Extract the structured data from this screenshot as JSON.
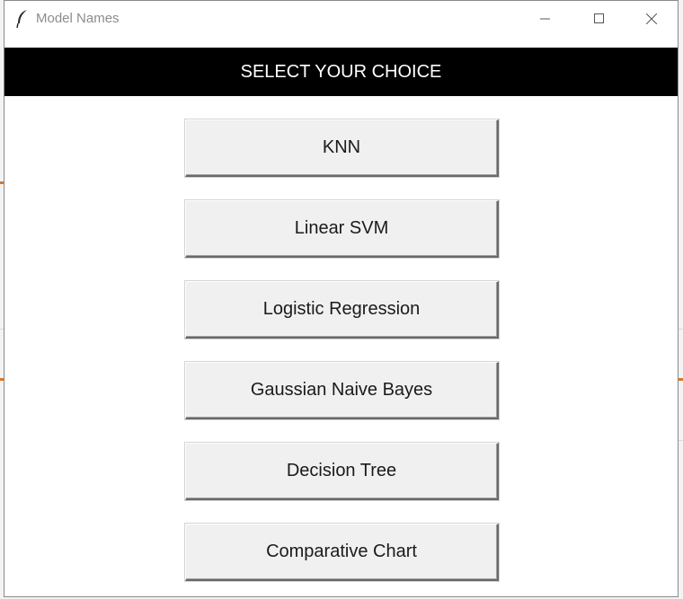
{
  "window": {
    "title": "Model Names"
  },
  "header": {
    "title": "SELECT YOUR CHOICE"
  },
  "choices": [
    {
      "label": "KNN"
    },
    {
      "label": "Linear SVM"
    },
    {
      "label": "Logistic Regression"
    },
    {
      "label": "Gaussian Naive Bayes"
    },
    {
      "label": "Decision Tree"
    },
    {
      "label": "Comparative Chart"
    }
  ],
  "colors": {
    "header_bg": "#000000",
    "header_text": "#ffffff",
    "button_bg": "#f0f0f0"
  },
  "icons": {
    "app": "feather-icon",
    "minimize": "minimize-icon",
    "maximize": "maximize-icon",
    "close": "close-icon"
  }
}
